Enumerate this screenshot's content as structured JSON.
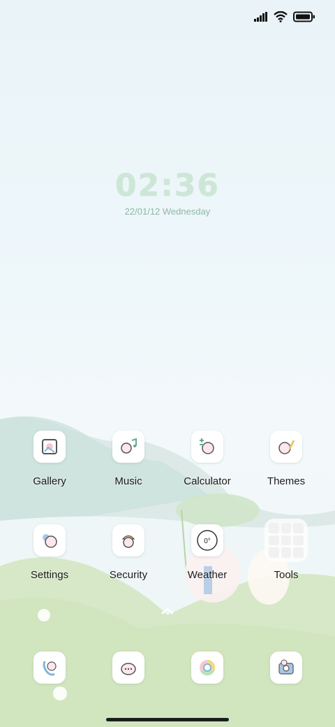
{
  "status_bar": {
    "icons": [
      "signal-icon",
      "wifi-icon",
      "battery-icon"
    ]
  },
  "clock": {
    "time": "02:36",
    "date": "22/01/12 Wednesday"
  },
  "apps": [
    {
      "label": "Gallery",
      "icon": "gallery-icon"
    },
    {
      "label": "Music",
      "icon": "music-icon"
    },
    {
      "label": "Calculator",
      "icon": "calculator-icon"
    },
    {
      "label": "Themes",
      "icon": "themes-icon"
    },
    {
      "label": "Settings",
      "icon": "settings-icon"
    },
    {
      "label": "Security",
      "icon": "security-icon"
    },
    {
      "label": "Weather",
      "icon": "weather-icon",
      "value": "0°"
    },
    {
      "label": "Tools",
      "icon": "tools-folder-icon"
    }
  ],
  "dock": [
    {
      "icon": "phone-icon"
    },
    {
      "icon": "messages-icon"
    },
    {
      "icon": "browser-icon"
    },
    {
      "icon": "camera-icon"
    }
  ],
  "colors": {
    "clock": "#cde6d6",
    "accent": "#8fb8a6"
  }
}
